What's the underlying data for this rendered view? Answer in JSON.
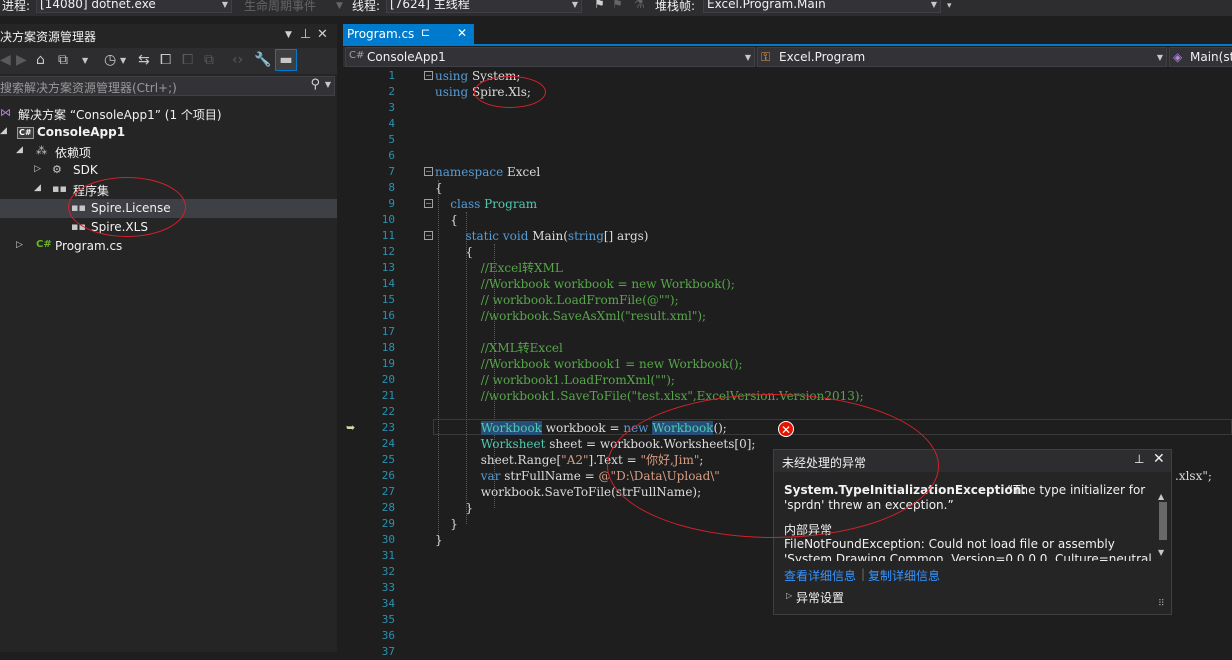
{
  "toolbar": {
    "process_label": "进程:",
    "process_value": "[14080] dotnet.exe",
    "lifecycle_label": "生命周期事件",
    "thread_label": "线程:",
    "thread_value": "[7624] 主线程",
    "stackframe_label": "堆栈帧:",
    "stackframe_value": "Excel.Program.Main"
  },
  "solution_explorer": {
    "title": "决方案资源管理器",
    "search_placeholder": "搜索解决方案资源管理器(Ctrl+;)",
    "tree": [
      {
        "label": "解决方案 “ConsoleApp1” (1 个项目)",
        "icon": "solution-icon"
      },
      {
        "label": "ConsoleApp1",
        "icon": "csharp-project-icon"
      },
      {
        "label": "依赖项",
        "icon": "dependencies-icon"
      },
      {
        "label": "SDK",
        "icon": "sdk-icon"
      },
      {
        "label": "程序集",
        "icon": "assemblies-icon"
      },
      {
        "label": "Spire.License",
        "icon": "assembly-icon"
      },
      {
        "label": "Spire.XLS",
        "icon": "assembly-icon"
      },
      {
        "label": "Program.cs",
        "icon": "csharp-file-icon"
      }
    ]
  },
  "editor": {
    "tab": {
      "label": "Program.cs",
      "pin": "⊏",
      "close": "✕"
    },
    "nav": {
      "project": "ConsoleApp1",
      "class": "Excel.Program",
      "member": "Main(st"
    },
    "lines": [
      "using System;",
      "using Spire.Xls;",
      "",
      "",
      "",
      "",
      "namespace Excel",
      "{",
      "    class Program",
      "    {",
      "        static void Main(string[] args)",
      "        {",
      "            //Excel转XML",
      "            //Workbook workbook = new Workbook();",
      "            // workbook.LoadFromFile(@\"\");",
      "            //workbook.SaveAsXml(\"result.xml\");",
      "",
      "            //XML转Excel",
      "            //Workbook workbook1 = new Workbook();",
      "            // workbook1.LoadFromXml(\"\");",
      "            //workbook1.SaveToFile(\"test.xlsx\",ExcelVersion.Version2013);",
      "",
      "            Workbook workbook = new Workbook();",
      "            Worksheet sheet = workbook.Worksheets[0];",
      "            sheet.Range[\"A2\"].Text = \"你好,Jim\";",
      "            var strFullName = @\"D:\\Data\\Upload\\\"",
      "            workbook.SaveToFile(strFullName);",
      "        }",
      "    }",
      "}",
      "",
      "",
      "",
      "",
      "",
      "",
      ""
    ],
    "line26_tail": ".xlsx\";"
  },
  "exception": {
    "title": "未经处理的异常",
    "type": "System.TypeInitializationException:",
    "message_1": "“The type initializer for",
    "message_2": "'sprdn' threw an exception.”",
    "inner_heading": "内部异常",
    "inner_1": "FileNotFoundException: Could not load file or assembly",
    "inner_2": "'System.Drawing.Common, Version=0.0.0.0, Culture=neutral,",
    "link_details": "查看详细信息",
    "link_copy": "复制详细信息",
    "settings": "异常设置"
  },
  "colors": {
    "accent": "#007acc",
    "annotation_circle": "#d4222a",
    "error": "#e51400"
  }
}
